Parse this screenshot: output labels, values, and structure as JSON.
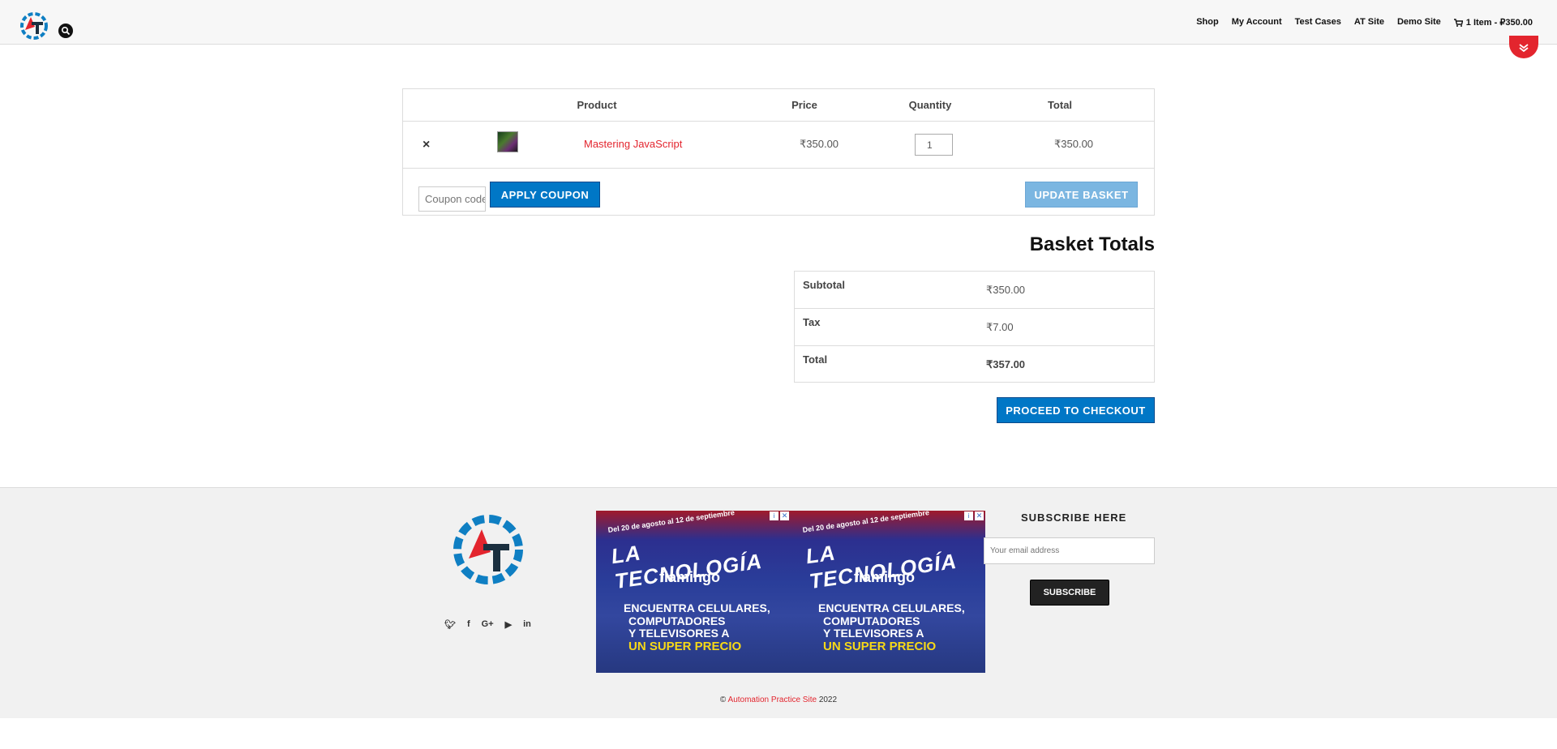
{
  "header": {
    "nav": [
      "Shop",
      "My Account",
      "Test Cases",
      "AT Site",
      "Demo Site"
    ],
    "cart_label": "1 Item - ₽350.00"
  },
  "cart": {
    "columns": [
      "Product",
      "Price",
      "Quantity",
      "Total"
    ],
    "items": [
      {
        "name": "Mastering JavaScript",
        "price": "₹350.00",
        "quantity": "1",
        "total": "₹350.00"
      }
    ],
    "coupon_placeholder": "Coupon code",
    "apply_coupon": "APPLY COUPON",
    "update_basket": "UPDATE BASKET",
    "remove_symbol": "×"
  },
  "totals": {
    "title": "Basket Totals",
    "rows": [
      {
        "label": "Subtotal",
        "value": "₹350.00"
      },
      {
        "label": "Tax",
        "value": "₹7.00"
      },
      {
        "label": "Total",
        "value": "₹357.00"
      }
    ],
    "checkout": "PROCEED TO CHECKOUT"
  },
  "ads": [
    {
      "date": "Del 20 de agosto al 12 de septiembre",
      "headline": "LA TECNOLOGÍA",
      "brand": "flamingo",
      "line1": "ENCUENTRA CELULARES,",
      "line2": "COMPUTADORES",
      "line3": "Y TELEVISORES A",
      "highlight": "UN SUPER PRECIO"
    },
    {
      "date": "Del 20 de agosto al 12 de septiembre",
      "headline": "LA TECNOLOGÍA",
      "brand": "flamingo",
      "line1": "ENCUENTRA CELULARES,",
      "line2": "COMPUTADORES",
      "line3": "Y TELEVISORES A",
      "highlight": "UN SUPER PRECIO"
    }
  ],
  "footer": {
    "subscribe_title": "SUBSCRIBE HERE",
    "email_placeholder": "Your email address",
    "subscribe_button": "SUBSCRIBE",
    "copyright_prefix": "©",
    "copyright_link": "Automation Practice Site",
    "copyright_year": "2022",
    "socials": [
      "twitter-icon",
      "facebook-icon",
      "google-plus-icon",
      "youtube-icon",
      "linkedin-icon"
    ]
  },
  "colors": {
    "accent_red": "#e3252e",
    "button_blue": "#0077c6",
    "button_disabled_blue": "#7bb6e1",
    "dark_button": "#222222"
  }
}
